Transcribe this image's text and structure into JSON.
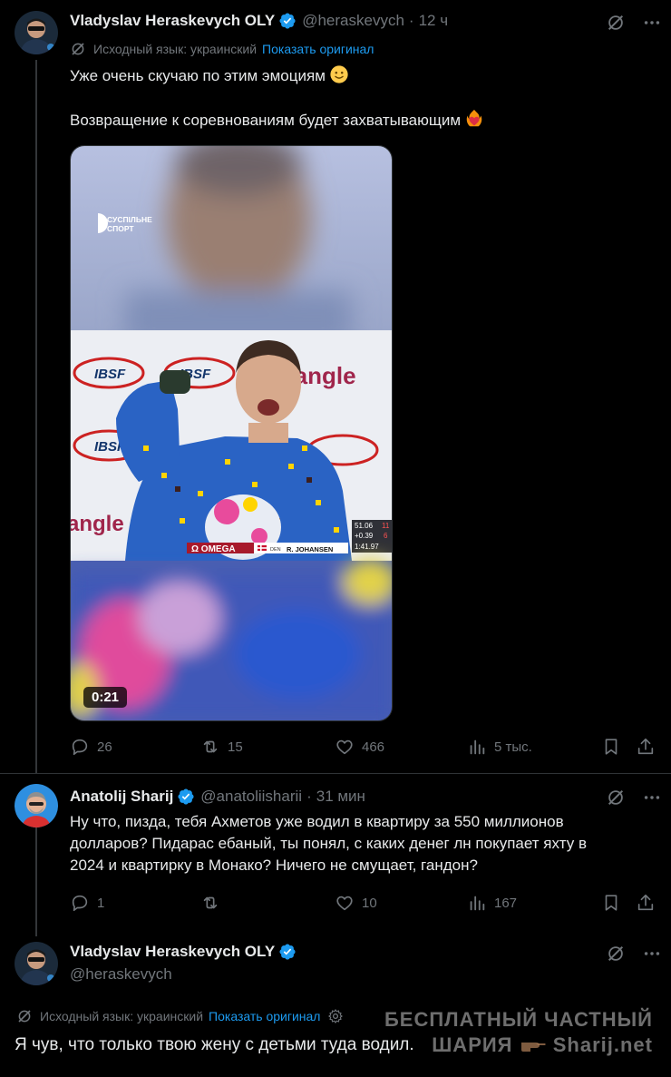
{
  "tweets": [
    {
      "author_name": "Vladyslav Heraskevych OLY",
      "handle": "@heraskevych",
      "separator": "·",
      "time": "12 ч",
      "translation_label": "Исходный язык: украинский",
      "show_original": "Показать оригинал",
      "text_line1": "Уже очень скучаю по этим эмоциям",
      "text_line2": "Возвращение к соревнованиям будет захватывающим",
      "video": {
        "duration": "0:21",
        "channel_logo_line1": "СУСПІЛЬНЕ",
        "channel_logo_line2": "СПОРТ",
        "banner_ibsf": "IBSF",
        "banner_brand": "tangle",
        "banner_brand_left": "angle",
        "scoreboard_omega": "Ω OMEGA",
        "scoreboard_athlete": "R. JOHANSEN",
        "scoreboard_country": "DEN",
        "scoreboard_time1": "51.06",
        "scoreboard_pos1": "11",
        "scoreboard_diff": "+0.39",
        "scoreboard_pos2": "6",
        "scoreboard_total": "1:41.97"
      },
      "replies": "26",
      "reposts": "15",
      "likes": "466",
      "views": "5 тыс."
    },
    {
      "author_name": "Anatolij Sharij",
      "handle": "@anatoliisharii",
      "separator": "·",
      "time": "31 мин",
      "text_line1": "Ну что, пизда, тебя Ахметов уже водил в квартиру за 550 миллионов",
      "text_line2": "долларов? Пидарас ебаный, ты понял, с каких денег лн покупает яхту в",
      "text_line3": "2024 и квартирку в Монако? Ничего не смущает, гандон?",
      "replies": "1",
      "reposts": "",
      "likes": "10",
      "views": "167"
    },
    {
      "author_name": "Vladyslav Heraskevych OLY",
      "handle": "@heraskevych",
      "translation_label": "Исходный язык: украинский",
      "show_original": "Показать оригинал",
      "text_line1": "Я чув, что только твою жену с детьми туда водил."
    }
  ],
  "watermark": {
    "line1": "БЕСПЛАТНЫЙ ЧАСТНЫЙ",
    "line2_left": "ШАРИЯ",
    "line2_right": "Sharij.net"
  },
  "colors": {
    "background": "#000000",
    "text": "#e7e9ea",
    "muted": "#71767b",
    "link": "#1d9bf0",
    "verified": "#1d9bf0",
    "divider": "#2f3336"
  },
  "icons": [
    "grok-icon",
    "more-icon",
    "verified-icon",
    "translate-icon",
    "reply-icon",
    "repost-icon",
    "like-icon",
    "views-icon",
    "bookmark-icon",
    "share-icon",
    "gear-icon",
    "slightly-smiling-face-emoji",
    "heart-on-fire-emoji"
  ]
}
